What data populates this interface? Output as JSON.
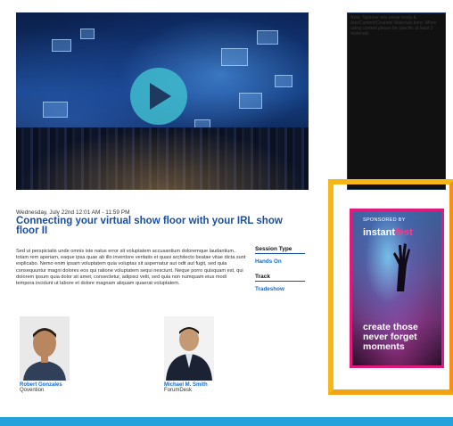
{
  "session": {
    "date": "Wednesday, July 22nd 12:01 AM - 11:59 PM",
    "title": "Connecting your virtual show floor with your IRL show floor II",
    "description": "Sed ut perspiciatis unde omnis iste natus error sit voluptatem accusantium doloremque laudantium, totam rem aperiam, eaque ipsa quae ab illo inventore veritatis et quasi architecto beatae vitae dicta sunt explicabo. Nemo enim ipsam voluptatem quia voluptas sit aspernatur aut odit aut fugit, sed quia consequuntur magni dolores eos qui ratione voluptatem sequi nesciunt. Neque porro quisquam est, qui dolorem ipsum quia dolor sit amet, consectetur, adipisci velit, sed quia non numquam eius modi tempora incidunt ut labore et dolore magnam aliquam quaerat voluptatem."
  },
  "meta": {
    "session_type_label": "Session Type",
    "session_type_value": "Hands On",
    "track_label": "Track",
    "track_value": "Tradeshow"
  },
  "speakers": [
    {
      "name": "Robert Gonzales",
      "org": "Qovention"
    },
    {
      "name": "Michael M. Smith",
      "org": "ForumDesk"
    }
  ],
  "sidebar": {
    "placeholder_text": "Note: Sponsor ads areas ready & Ads/Content/Channel Materials here: When using content please be specific at least 3 materials"
  },
  "ad": {
    "sponsored_by": "SPONSORED BY",
    "brand_prefix": "instant",
    "brand_suffix": "fest",
    "tagline": "create those never forget moments"
  },
  "icons": {
    "play": "play-icon"
  },
  "colors": {
    "link_blue": "#1a6bc9",
    "title_blue": "#1a4fa0",
    "play_teal": "#40bcce",
    "ad_border": "#e0197a",
    "gold_frame": "#f7b617",
    "footer": "#25a2dc"
  }
}
